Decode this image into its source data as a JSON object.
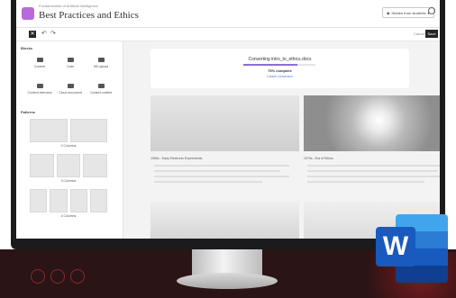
{
  "header": {
    "course_label": "Fundamentals of Artificial Intelligence",
    "title": "Best Practices and Ethics",
    "visibility_label": "Hidden from students"
  },
  "toolbar": {
    "cancel_label": "Cancel",
    "save_label": "Save"
  },
  "left_panel": {
    "blocks_heading": "Blocks",
    "blocks": [
      {
        "label": "Content",
        "icon": "content-icon"
      },
      {
        "label": "Code",
        "icon": "code-icon"
      },
      {
        "label": "HB upload",
        "icon": "upload-icon"
      },
      {
        "label": "Content interview",
        "icon": "content-interview-icon"
      },
      {
        "label": "Cloud document",
        "icon": "cloud-document-icon"
      },
      {
        "label": "Content crafted",
        "icon": "content-crafted-icon"
      }
    ],
    "patterns_heading": "Patterns",
    "layouts": [
      {
        "label": "2 Columns",
        "columns": 2
      },
      {
        "label": "3 Columns",
        "columns": 3
      },
      {
        "label": "4 Columns",
        "columns": 4
      }
    ]
  },
  "conversion": {
    "title": "Converting intro_to_ethics.docx",
    "percent_label": "75% complete",
    "progress": 0.75,
    "cancel_label": "Cancel conversion"
  },
  "content": {
    "caption_left": "1950s - Early Electronic Experiments",
    "caption_right": "1970s - Era of Ethics"
  },
  "branding": {
    "word_letter": "W"
  },
  "colors": {
    "accent_purple": "#8c6fd0",
    "logo_purple": "#b86bd8",
    "word_blue": "#185abd"
  }
}
